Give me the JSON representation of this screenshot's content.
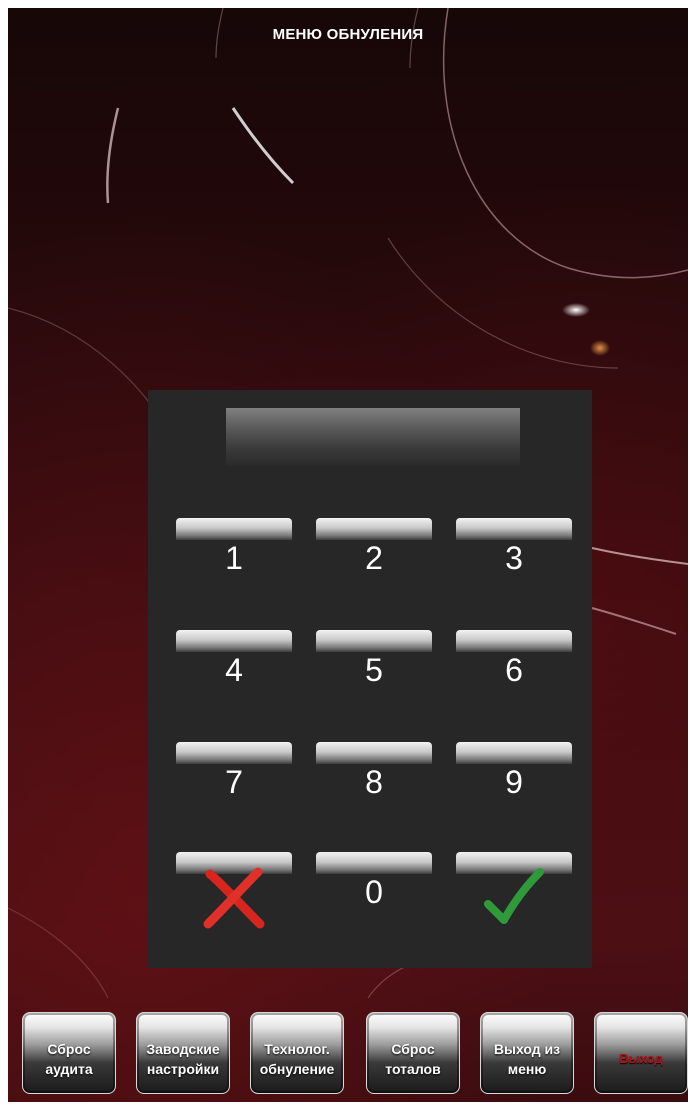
{
  "title": "МЕНЮ ОБНУЛЕНИЯ",
  "display": {
    "value": ""
  },
  "keypad": {
    "keys": [
      "1",
      "2",
      "3",
      "4",
      "5",
      "6",
      "7",
      "8",
      "9",
      "0"
    ],
    "cancel_icon": "red-x-icon",
    "confirm_icon": "green-check-icon"
  },
  "footer": {
    "buttons": [
      "Сброс\nаудита",
      "Заводские\nнастройки",
      "Технолог.\nобнуление",
      "Сброс\nтоталов",
      "Выход из\nменю",
      "Выход"
    ]
  },
  "colors": {
    "background": "#3a0c0f",
    "panel": "#272727",
    "cancel": "#d8261f",
    "confirm": "#2e9a3a",
    "exit_text": "#b21117"
  }
}
